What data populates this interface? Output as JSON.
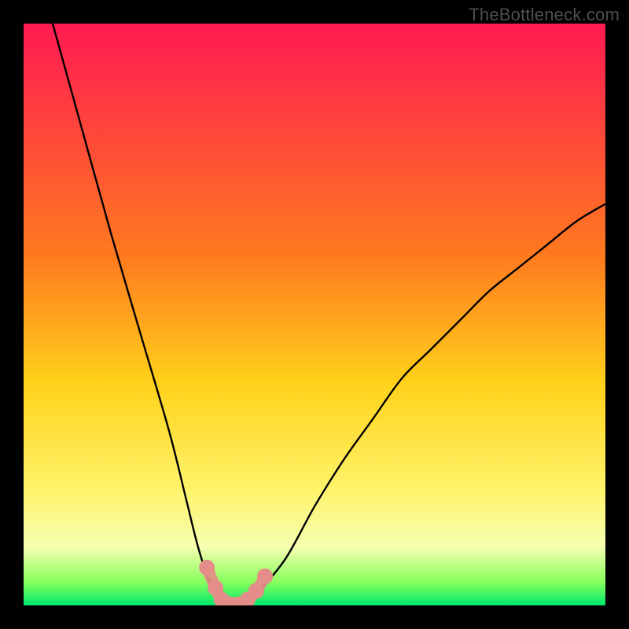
{
  "watermark": "TheBottleneck.com",
  "chart_data": {
    "type": "line",
    "title": "",
    "xlabel": "",
    "ylabel": "",
    "xlim": [
      0,
      100
    ],
    "ylim": [
      0,
      100
    ],
    "series": [
      {
        "name": "bottleneck-curve",
        "x": [
          5,
          10,
          15,
          20,
          25,
          28,
          30,
          32,
          34,
          36,
          38,
          40,
          45,
          50,
          55,
          60,
          65,
          70,
          75,
          80,
          85,
          90,
          95,
          100
        ],
        "values": [
          100,
          82,
          64,
          47,
          30,
          18,
          10,
          4,
          1,
          0,
          0.5,
          2,
          8,
          17,
          25,
          32,
          39,
          44,
          49,
          54,
          58,
          62,
          66,
          69
        ]
      }
    ],
    "markers": {
      "name": "highlighted-points",
      "color": "#e58d89",
      "x": [
        31.5,
        33,
        34,
        35.5,
        37,
        38.5,
        40,
        41.5
      ],
      "values": [
        6.5,
        3,
        1,
        0.2,
        0.2,
        1,
        2.5,
        5
      ]
    },
    "gradient_stops": [
      {
        "offset": 0,
        "color": "#ff1a52"
      },
      {
        "offset": 40,
        "color": "#ff7a1f"
      },
      {
        "offset": 62,
        "color": "#ffd21a"
      },
      {
        "offset": 80,
        "color": "#fff36a"
      },
      {
        "offset": 90,
        "color": "#f4ffb0"
      },
      {
        "offset": 96,
        "color": "#87ff5c"
      },
      {
        "offset": 100,
        "color": "#00e86b"
      }
    ]
  }
}
